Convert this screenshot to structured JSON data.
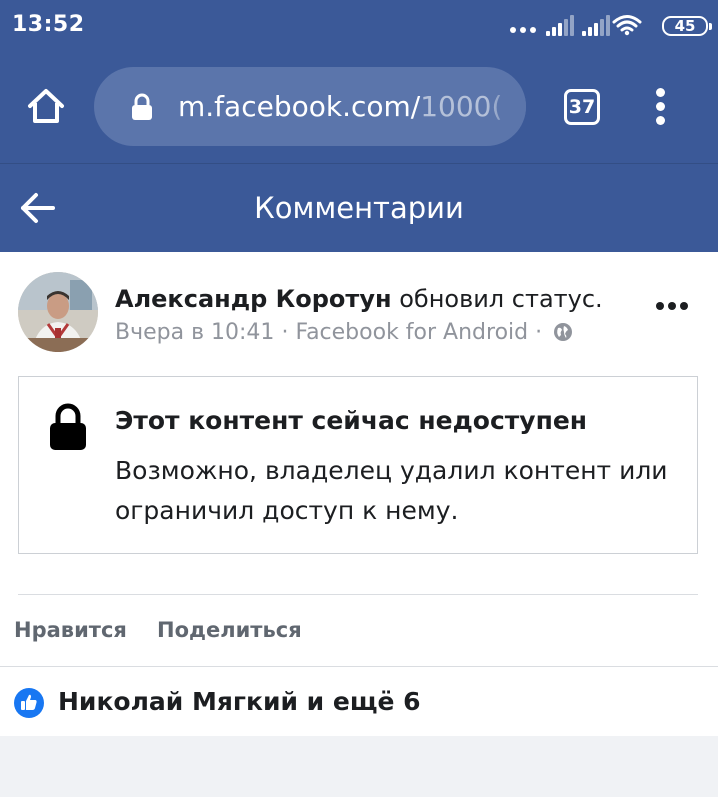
{
  "status_bar": {
    "time": "13:52",
    "battery": "45"
  },
  "browser": {
    "url_main": "m.facebook.com/",
    "url_rest": "1000(",
    "tab_count": "37"
  },
  "header": {
    "title": "Комментарии"
  },
  "post": {
    "author": "Александр Коротун",
    "action": "обновил статус.",
    "time": "Вчера в 10:41",
    "separator": "·",
    "source": "Facebook for Android",
    "separator2": "·"
  },
  "unavailable": {
    "title": "Этот контент сейчас недоступен",
    "text": "Возможно, владелец удалил контент или ограничил доступ к нему."
  },
  "actions": {
    "like": "Нравится",
    "share": "Поделиться"
  },
  "likes": {
    "text": "Николай Мягкий и ещё 6"
  },
  "colors": {
    "brand": "#3b5998",
    "like_blue": "#1877f2"
  }
}
